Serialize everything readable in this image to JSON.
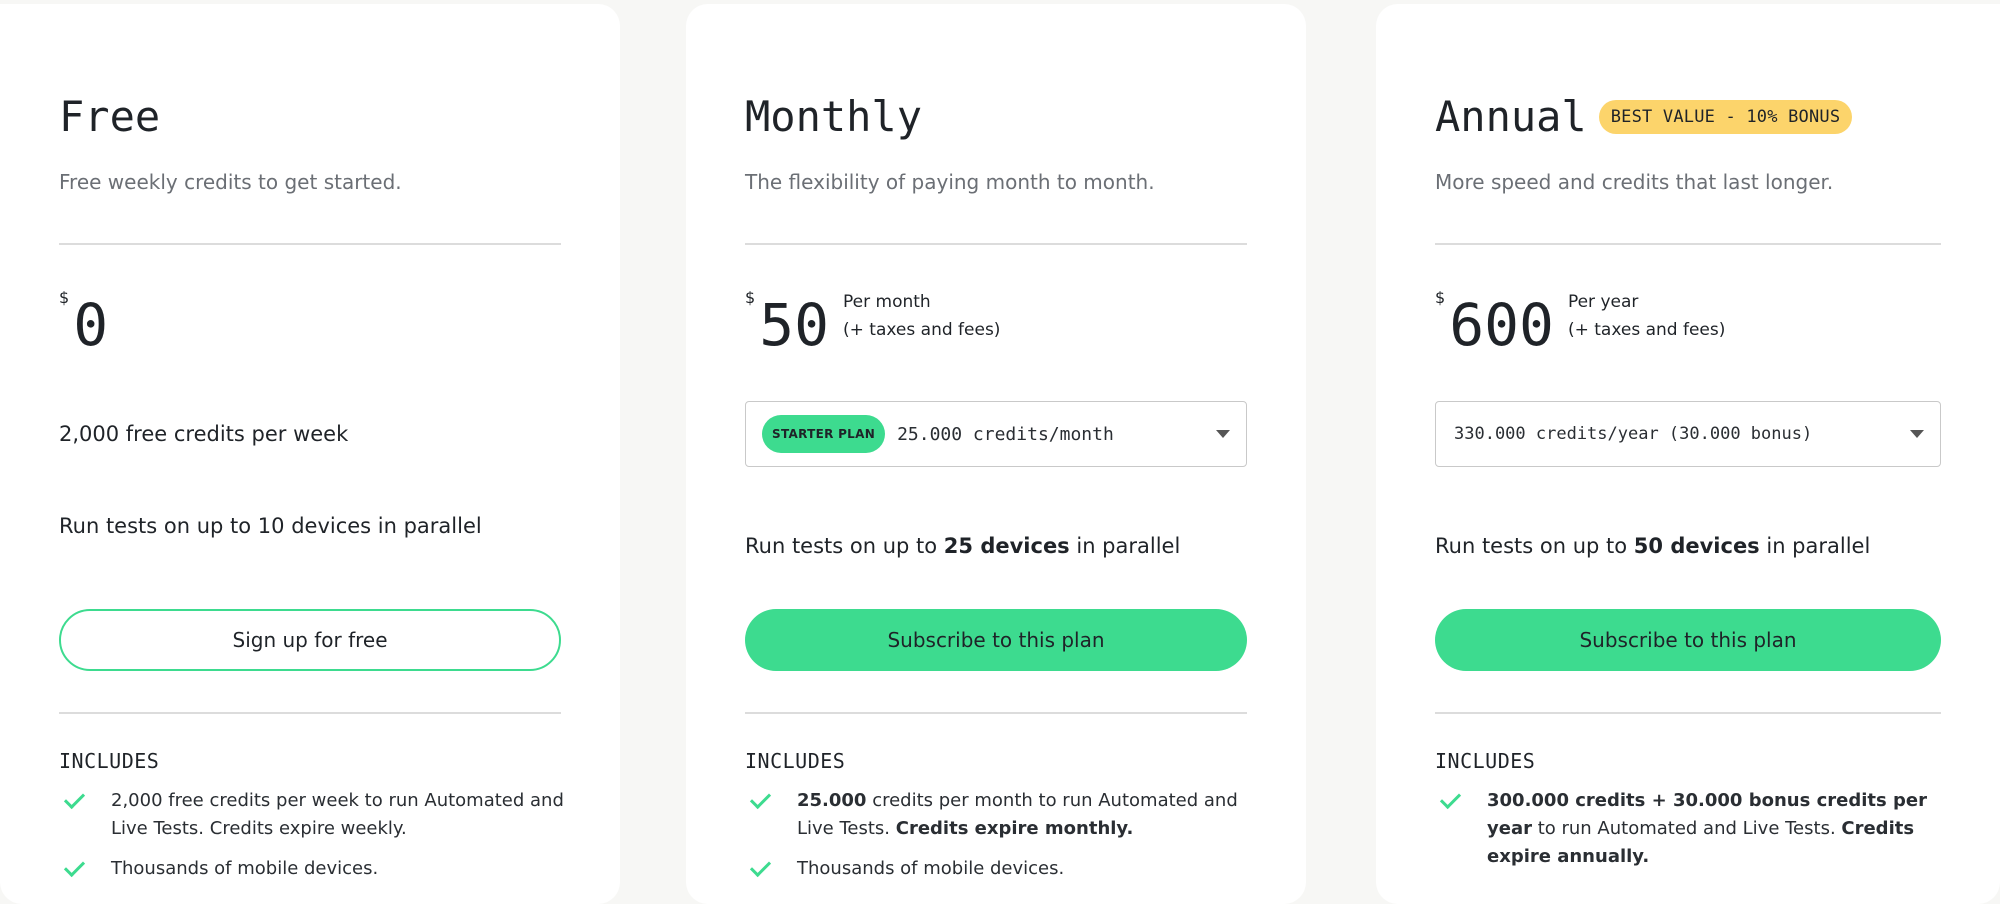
{
  "colors": {
    "accent": "#3ddb8f",
    "badge": "#fcd46b",
    "background": "#f7f7f5"
  },
  "plans": [
    {
      "title": "Free",
      "subtitle": "Free weekly credits to get started.",
      "currency": "$",
      "amount": "0",
      "credits_text": "2,000 free credits per week",
      "devices_text": "Run tests on up to 10 devices in parallel",
      "cta": "Sign up for free",
      "includes_label": "INCLUDES",
      "features": [
        "2,000 free credits per week to run Automated and Live Tests. Credits expire weekly.",
        "Thousands of mobile devices."
      ]
    },
    {
      "title": "Monthly",
      "subtitle": "The flexibility of paying month to month.",
      "currency": "$",
      "amount": "50",
      "period_line1": "Per month",
      "period_line2": "(+ taxes and fees)",
      "select_tag": "STARTER PLAN",
      "select_value": "25.000 credits/month",
      "devices_prefix": "Run tests on up to ",
      "devices_bold": "25 devices",
      "devices_suffix": " in parallel",
      "cta": "Subscribe to this plan",
      "includes_label": "INCLUDES",
      "feature1_bold": "25.000",
      "feature1_mid": " credits per month to run Automated and Live Tests. ",
      "feature1_bold2": "Credits expire monthly.",
      "feature2": "Thousands of mobile devices."
    },
    {
      "title": "Annual",
      "badge": "BEST VALUE - 10% BONUS",
      "subtitle": "More speed and credits that last longer.",
      "currency": "$",
      "amount": "600",
      "period_line1": "Per year",
      "period_line2": "(+ taxes and fees)",
      "select_value": "330.000 credits/year (30.000 bonus)",
      "devices_prefix": "Run tests on up to ",
      "devices_bold": "50 devices",
      "devices_suffix": " in parallel",
      "cta": "Subscribe to this plan",
      "includes_label": "INCLUDES",
      "feature1_bold": "300.000 credits + 30.000 bonus credits per year",
      "feature1_mid": " to run Automated and Live Tests. ",
      "feature1_bold2": "Credits expire annually."
    }
  ]
}
